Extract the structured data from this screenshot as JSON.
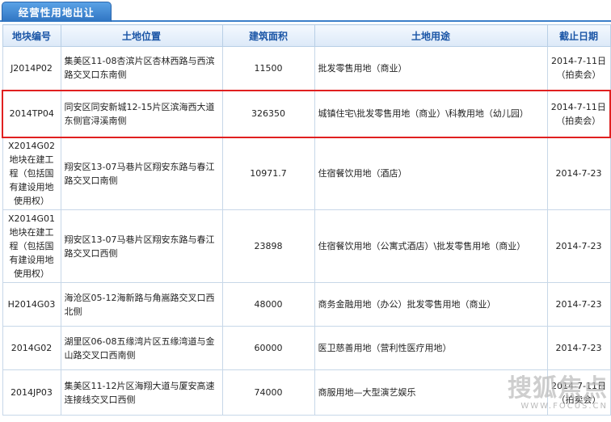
{
  "tab": {
    "label": "经营性用地出让"
  },
  "columns": [
    "地块编号",
    "土地位置",
    "建筑面积",
    "土地用途",
    "截止日期"
  ],
  "rows": [
    {
      "id": "J2014P02",
      "location": "集美区11-08杏滨片区杏林西路与西滨路交叉口东南侧",
      "area": "11500",
      "use": "批发零售用地（商业）",
      "deadline": "2014-7-11日（拍卖会）",
      "highlight": false
    },
    {
      "id": "2014TP04",
      "location": "同安区同安新城12-15片区滨海西大道东侧官浔溪南侧",
      "area": "326350",
      "use": "城镇住宅\\批发零售用地（商业）\\科教用地（幼儿园）",
      "deadline": "2014-7-11日（拍卖会）",
      "highlight": true
    },
    {
      "id": "X2014G02地块在建工程（包括国有建设用地使用权）",
      "location": "翔安区13-07马巷片区翔安东路与春江路交叉口南侧",
      "area": "10971.7",
      "use": "住宿餐饮用地（酒店）",
      "deadline": "2014-7-23",
      "highlight": false
    },
    {
      "id": "X2014G01地块在建工程（包括国有建设用地使用权）",
      "location": "翔安区13-07马巷片区翔安东路与春江路交叉口西侧",
      "area": "23898",
      "use": "住宿餐饮用地（公寓式酒店）\\批发零售用地（商业）",
      "deadline": "2014-7-23",
      "highlight": false
    },
    {
      "id": "H2014G03",
      "location": "海沧区05-12海新路与角嵩路交叉口西北侧",
      "area": "48000",
      "use": "商务金融用地（办公）批发零售用地（商业）",
      "deadline": "2014-7-23",
      "highlight": false
    },
    {
      "id": "2014G02",
      "location": "湖里区06-08五缘湾片区五缘湾道与金山路交叉口西南侧",
      "area": "60000",
      "use": "医卫慈善用地（营利性医疗用地）",
      "deadline": "2014-7-23",
      "highlight": false
    },
    {
      "id": "2014JP03",
      "location": "集美区11-12片区海翔大道与厦安高速连接线交叉口西侧",
      "area": "74000",
      "use": "商服用地—大型演艺娱乐",
      "deadline": "2014-7-11日（拍卖会）",
      "highlight": false
    }
  ],
  "watermark": {
    "text": "搜狐焦点",
    "url": "WWW.FOCUS.CN"
  }
}
